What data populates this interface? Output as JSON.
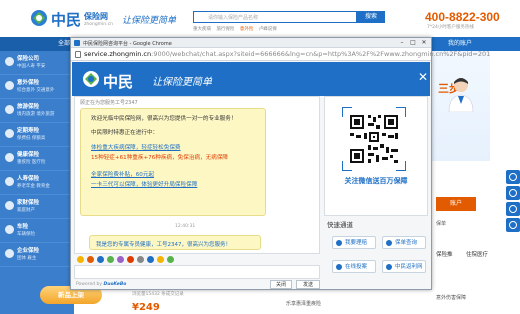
{
  "site": {
    "logo": "中民",
    "logo_sub": "保险网",
    "logo_url": "zhongmin.cn",
    "slogan": "让保险更简单",
    "search_placeholder": "请你输入保险产品名称",
    "search_button": "搜索",
    "hotwords": [
      "重大疾病",
      "旅行保险",
      "意外险",
      "卢峰说保"
    ],
    "phone": "400-8822-300",
    "phone_sub": "7*24小时客户服务热线",
    "nav_all": "全部",
    "my_account": "我的账户",
    "banner_text": "三步",
    "right_button": "账户",
    "right_rows": [
      "保单",
      "住院医疗",
      "意外伤害保障"
    ],
    "right_tabs": [
      "保险推",
      "住院医疗"
    ],
    "new_badge": "新品上架",
    "price": "¥249",
    "bottom_info": "浏览量15432 条成交记录",
    "prod_link": "乐享惠泽重疾险"
  },
  "left_categories": [
    {
      "title": "保险公司",
      "sub": "中国人寿 平安"
    },
    {
      "title": "意外保险",
      "sub": "综合意外 交通意外"
    },
    {
      "title": "旅游保险",
      "sub": "境内旅游 境外旅游"
    },
    {
      "title": "定期寿险",
      "sub": "保费低 保额高"
    },
    {
      "title": "健康保险",
      "sub": "重疾险 医疗险"
    },
    {
      "title": "人寿保险",
      "sub": "养老年金 教育金"
    },
    {
      "title": "家财保险",
      "sub": "家庭财产"
    },
    {
      "title": "车险",
      "sub": "车辆保险"
    },
    {
      "title": "企业保险",
      "sub": "团体 雇主"
    }
  ],
  "window": {
    "title": "中民保险网咨询平台 - Google Chrome",
    "url_host": "service.zhongmin.cn",
    "url_rest": ":9000/webchat/chat.aspx?siteid=666666&lng=cn&p=http%3A%2F%2Fwww.zhongmin.cn%2F&pid=201",
    "min": "–",
    "max": "□",
    "close": "✕"
  },
  "chat": {
    "header_logo": "中民",
    "header_slogan": "让保险更简单",
    "status_line": "顾正在为您服务工号2347",
    "messages": {
      "intro": "欢迎光临中民保险网，很高兴为您提供一对一的专业服务！",
      "promo_title": "中民限时特惠正在进行中：",
      "link1": "体检重大疾病保障，轻症轻松免保费",
      "red1a": "15种轻症+61种重疾+76种疾病，免保治病，无病保障",
      "link2": "全家保险费补贴，60元起",
      "link3": "一卡三代可以保障，体验更好升局保险保障",
      "time": "12:40:31",
      "greet": "我是您的专属专员健康，工号2347，很高兴为您服务！"
    },
    "powered_prefix": "Powered by",
    "powered_brand": "DuoKeBo",
    "close_button": "关闭",
    "send_button": "发送"
  },
  "qr": {
    "caption": "关注微信送百万保障"
  },
  "quick": {
    "title": "快速通道",
    "buttons": [
      "我要理赔",
      "保单查询",
      "在线投案",
      "中民返利网"
    ]
  },
  "colors": {
    "brand_blue": "#1e6fc5",
    "accent_orange": "#e35b00",
    "bubble_yellow": "#fdf7c4"
  }
}
